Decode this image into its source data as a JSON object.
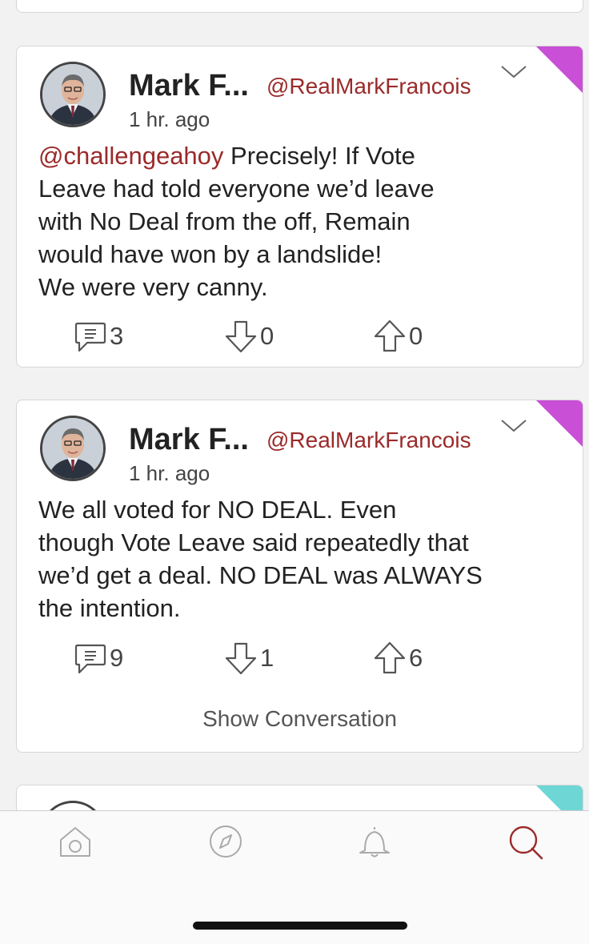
{
  "colors": {
    "handle": "#9b2a2a",
    "corner_magenta": "#c94fd6",
    "corner_cyan": "#6fd6d6",
    "active_tab": "#9b2a2a"
  },
  "posts": [
    {
      "name": "Mark F...",
      "handle": "@RealMarkFrancois",
      "time": "1 hr. ago",
      "mention": "@challengeahoy",
      "text_lines": [
        " Precisely! If Vote",
        "Leave had told everyone we’d leave",
        "with No Deal from the off, Remain",
        "would have won by a landslide!",
        "We were very canny."
      ],
      "replies": "3",
      "downvotes": "0",
      "upvotes": "0"
    },
    {
      "name": "Mark F...",
      "handle": "@RealMarkFrancois",
      "time": "1 hr. ago",
      "text_lines": [
        "We all voted for NO DEAL. Even",
        "though Vote Leave said repeatedly that",
        "we’d get a deal. NO DEAL was ALWAYS",
        "the intention."
      ],
      "replies": "9",
      "downvotes": "1",
      "upvotes": "6",
      "show_conversation": "Show Conversation"
    }
  ],
  "tabs": [
    {
      "icon": "home-icon"
    },
    {
      "icon": "compass-icon"
    },
    {
      "icon": "bell-icon"
    },
    {
      "icon": "search-icon",
      "active": true
    }
  ]
}
